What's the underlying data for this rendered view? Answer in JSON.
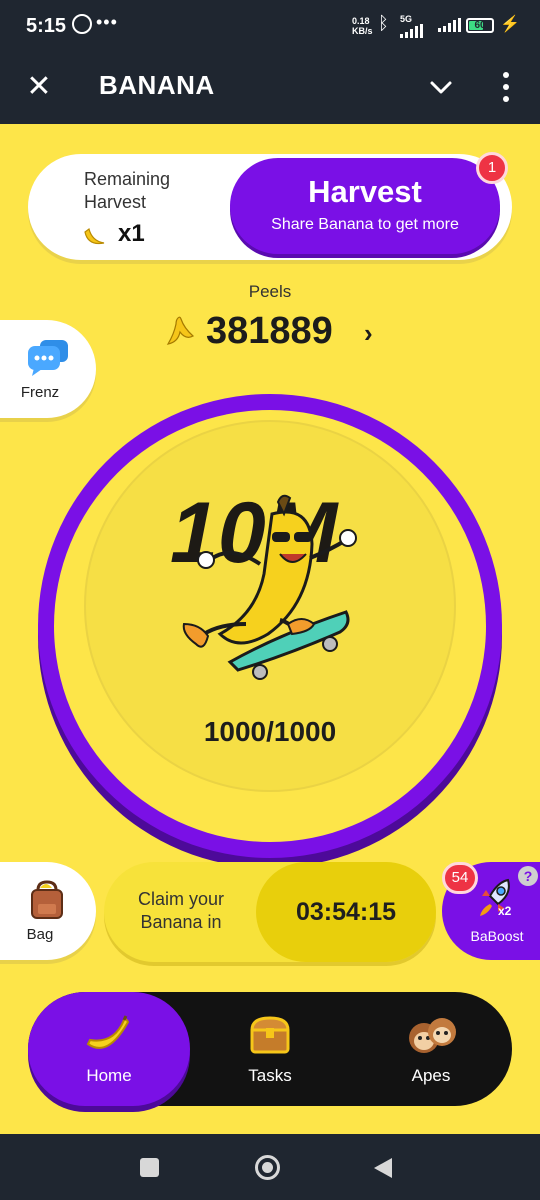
{
  "status_bar": {
    "time": "5:15",
    "net_speed_value": "0.18",
    "net_speed_unit": "KB/s",
    "network_type": "5G",
    "battery": "60"
  },
  "app_bar": {
    "title": "BANANA"
  },
  "harvest": {
    "remaining_label": "Remaining Harvest",
    "remaining_count": "x1",
    "button_title": "Harvest",
    "button_subtitle": "Share Banana to get more",
    "badge": "1"
  },
  "peels": {
    "label": "Peels",
    "value": "381889"
  },
  "friends_button": {
    "label": "Frenz"
  },
  "mascot": {
    "emblem_text": "10M",
    "energy": "1000/1000"
  },
  "bag_button": {
    "label": "Bag"
  },
  "claim": {
    "label": "Claim your Banana in",
    "timer": "03:54:15"
  },
  "boost": {
    "label": "BaBoost",
    "badge": "54",
    "multiplier": "x2",
    "help": "?"
  },
  "bottom_nav": {
    "items": [
      {
        "label": "Home",
        "icon": "banana-icon",
        "active": true
      },
      {
        "label": "Tasks",
        "icon": "chest-icon",
        "active": false
      },
      {
        "label": "Apes",
        "icon": "monkeys-icon",
        "active": false
      }
    ]
  },
  "colors": {
    "background": "#fde549",
    "accent_purple": "#7a10e6",
    "nav_dark": "#121212",
    "badge_red": "#ee3344",
    "header_dark": "#1f2630"
  }
}
